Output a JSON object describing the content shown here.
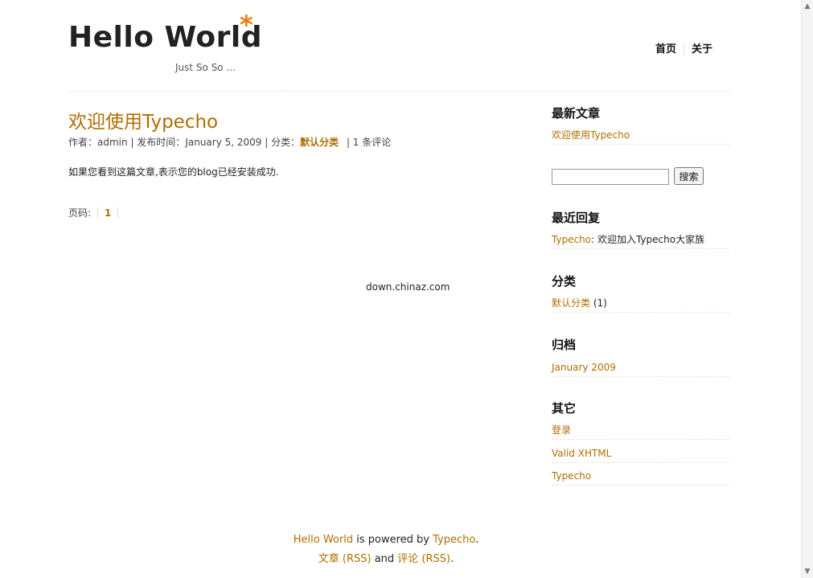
{
  "header": {
    "logo": "Hello World",
    "star": "*",
    "tagline": "Just So So ..."
  },
  "nav": {
    "home": "首页",
    "about": "关于"
  },
  "post": {
    "title": "欢迎使用Typecho",
    "author_label": "作者：",
    "author": "admin",
    "date_label": " | 发布时间：",
    "date": "January 5, 2009",
    "category_label": " | 分类：",
    "category": "默认分类",
    "comments": " | 1 条评论",
    "body": "如果您看到这篇文章,表示您的blog已经安装成功."
  },
  "pager": {
    "label": "页码:",
    "current": "1"
  },
  "watermark": "down.chinaz.com",
  "sidebar": {
    "recent_posts_heading": "最新文章",
    "recent_post": "欢迎使用Typecho",
    "search_button": "搜索",
    "search_value": "",
    "recent_comments_heading": "最近回复",
    "comment_author": "Typecho",
    "comment_text": ": 欢迎加入Typecho大家族",
    "categories_heading": "分类",
    "category_name": "默认分类",
    "category_count": " (1)",
    "archives_heading": "归档",
    "archive": "January 2009",
    "other_heading": "其它",
    "other_links": [
      "登录",
      "Valid XHTML",
      "Typecho"
    ]
  },
  "footer": {
    "site": "Hello World",
    "powered": " is powered by ",
    "typecho": "Typecho",
    "period": ".",
    "posts_rss": "文章 (RSS)",
    "and": " and ",
    "comments_rss": "评论 (RSS)",
    "period2": "."
  }
}
